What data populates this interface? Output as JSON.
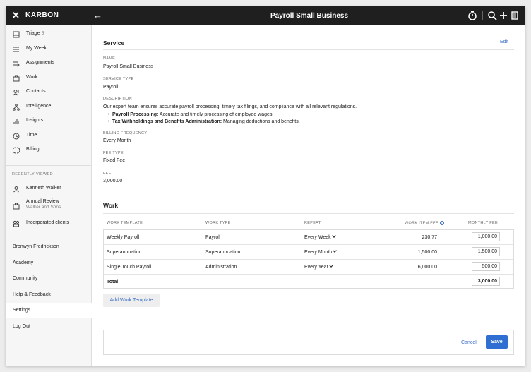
{
  "topbar": {
    "close_glyph": "✕",
    "brand": "KARBON",
    "back_glyph": "←",
    "title": "Payroll Small Business",
    "icons": [
      "timer-icon",
      "search-icon",
      "plus-icon",
      "notes-icon"
    ]
  },
  "sidebar": {
    "items": [
      {
        "label": "Triage",
        "badge": "9",
        "icon": "inbox-icon"
      },
      {
        "label": "My Week",
        "icon": "list-icon"
      },
      {
        "label": "Assignments",
        "icon": "assign-icon"
      },
      {
        "label": "Work",
        "icon": "briefcase-icon"
      },
      {
        "label": "Contacts",
        "icon": "contacts-icon"
      },
      {
        "label": "Intelligence",
        "icon": "network-icon"
      },
      {
        "label": "Insights",
        "icon": "bar-chart-icon"
      },
      {
        "label": "Time",
        "icon": "clock-icon"
      },
      {
        "label": "Billing",
        "icon": "billing-icon"
      }
    ],
    "recently_viewed_heading": "RECENTLY VIEWED",
    "recent": [
      {
        "label": "Kenneth Walker",
        "icon": "person-icon"
      },
      {
        "label": "Annual Review",
        "sub": "Walker and Sons",
        "icon": "briefcase-icon"
      },
      {
        "label": "Incorporated clients",
        "icon": "group-icon"
      }
    ],
    "bottom": [
      {
        "label": "Bronwyn Fredrickson"
      },
      {
        "label": "Academy"
      },
      {
        "label": "Community"
      },
      {
        "label": "Help & Feedback"
      },
      {
        "label": "Settings",
        "active": true
      },
      {
        "label": "Log Out"
      }
    ]
  },
  "service": {
    "heading": "Service",
    "edit_label": "Edit",
    "name_label": "NAME",
    "name": "Payroll Small Business",
    "type_label": "SERVICE TYPE",
    "type": "Payroll",
    "description_label": "DESCRIPTION",
    "description": "Our expert team ensures accurate payroll processing, timely tax filings, and compliance with all relevant regulations.",
    "bullets": [
      {
        "bold": "Payroll Processing:",
        "text": " Accurate and timely processing of employee wages."
      },
      {
        "bold": "Tax Withholdings and Benefits Administration:",
        "text": " Managing deductions and benefits."
      }
    ],
    "billing_label": "BILLING FREQUENCY",
    "billing": "Every Month",
    "fee_type_label": "FEE TYPE",
    "fee_type": "Fixed Fee",
    "fee_label": "FEE",
    "fee": "3,000.00"
  },
  "work": {
    "heading": "Work",
    "columns": [
      "WORK TEMPLATE",
      "WORK TYPE",
      "REPEAT",
      "WORK ITEM FEE",
      "MONTHLY FEE"
    ],
    "rows": [
      {
        "template": "Weekly Payroll",
        "type": "Payroll",
        "repeat": "Every Week",
        "item_fee": "230.77",
        "monthly_fee": "1,000.00"
      },
      {
        "template": "Superannuation",
        "type": "Superannuation",
        "repeat": "Every Month",
        "item_fee": "1,500.00",
        "monthly_fee": "1,500.00"
      },
      {
        "template": "Single Touch Payroll",
        "type": "Administration",
        "repeat": "Every Year",
        "item_fee": "6,000.00",
        "monthly_fee": "500.00"
      }
    ],
    "total_label": "Total",
    "total_value": "3,000.00",
    "add_button": "Add Work Template",
    "info_glyph": "i"
  },
  "footer": {
    "cancel_label": "Cancel",
    "save_label": "Save"
  },
  "colors": {
    "topbar": "#1f1f1f",
    "link": "#3a6fc8",
    "primary_button": "#2f6fd1"
  }
}
